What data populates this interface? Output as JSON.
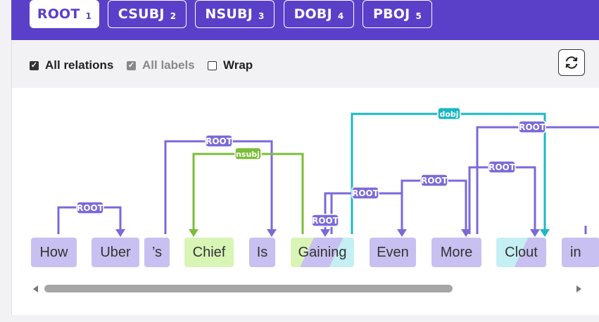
{
  "tabs": [
    {
      "label": "ROOT",
      "count": "1"
    },
    {
      "label": "CSUBJ",
      "count": "2"
    },
    {
      "label": "NSUBJ",
      "count": "3"
    },
    {
      "label": "DOBJ",
      "count": "4"
    },
    {
      "label": "PBOJ",
      "count": "5"
    }
  ],
  "options": {
    "all_relations": "All relations",
    "all_labels": "All labels",
    "wrap": "Wrap"
  },
  "tokens": [
    "How",
    "Uber",
    "’s",
    "Chief",
    "Is",
    "Gaining",
    "Even",
    "More",
    "Clout",
    "in"
  ],
  "arcs": {
    "root": "ROOT",
    "nsubj": "nsubj",
    "dobj": "dobj"
  },
  "colors": {
    "header": "#5a40c9",
    "root": "#7a6ad8",
    "nsubj": "#7dbd3a",
    "dobj": "#1cb7c5"
  }
}
